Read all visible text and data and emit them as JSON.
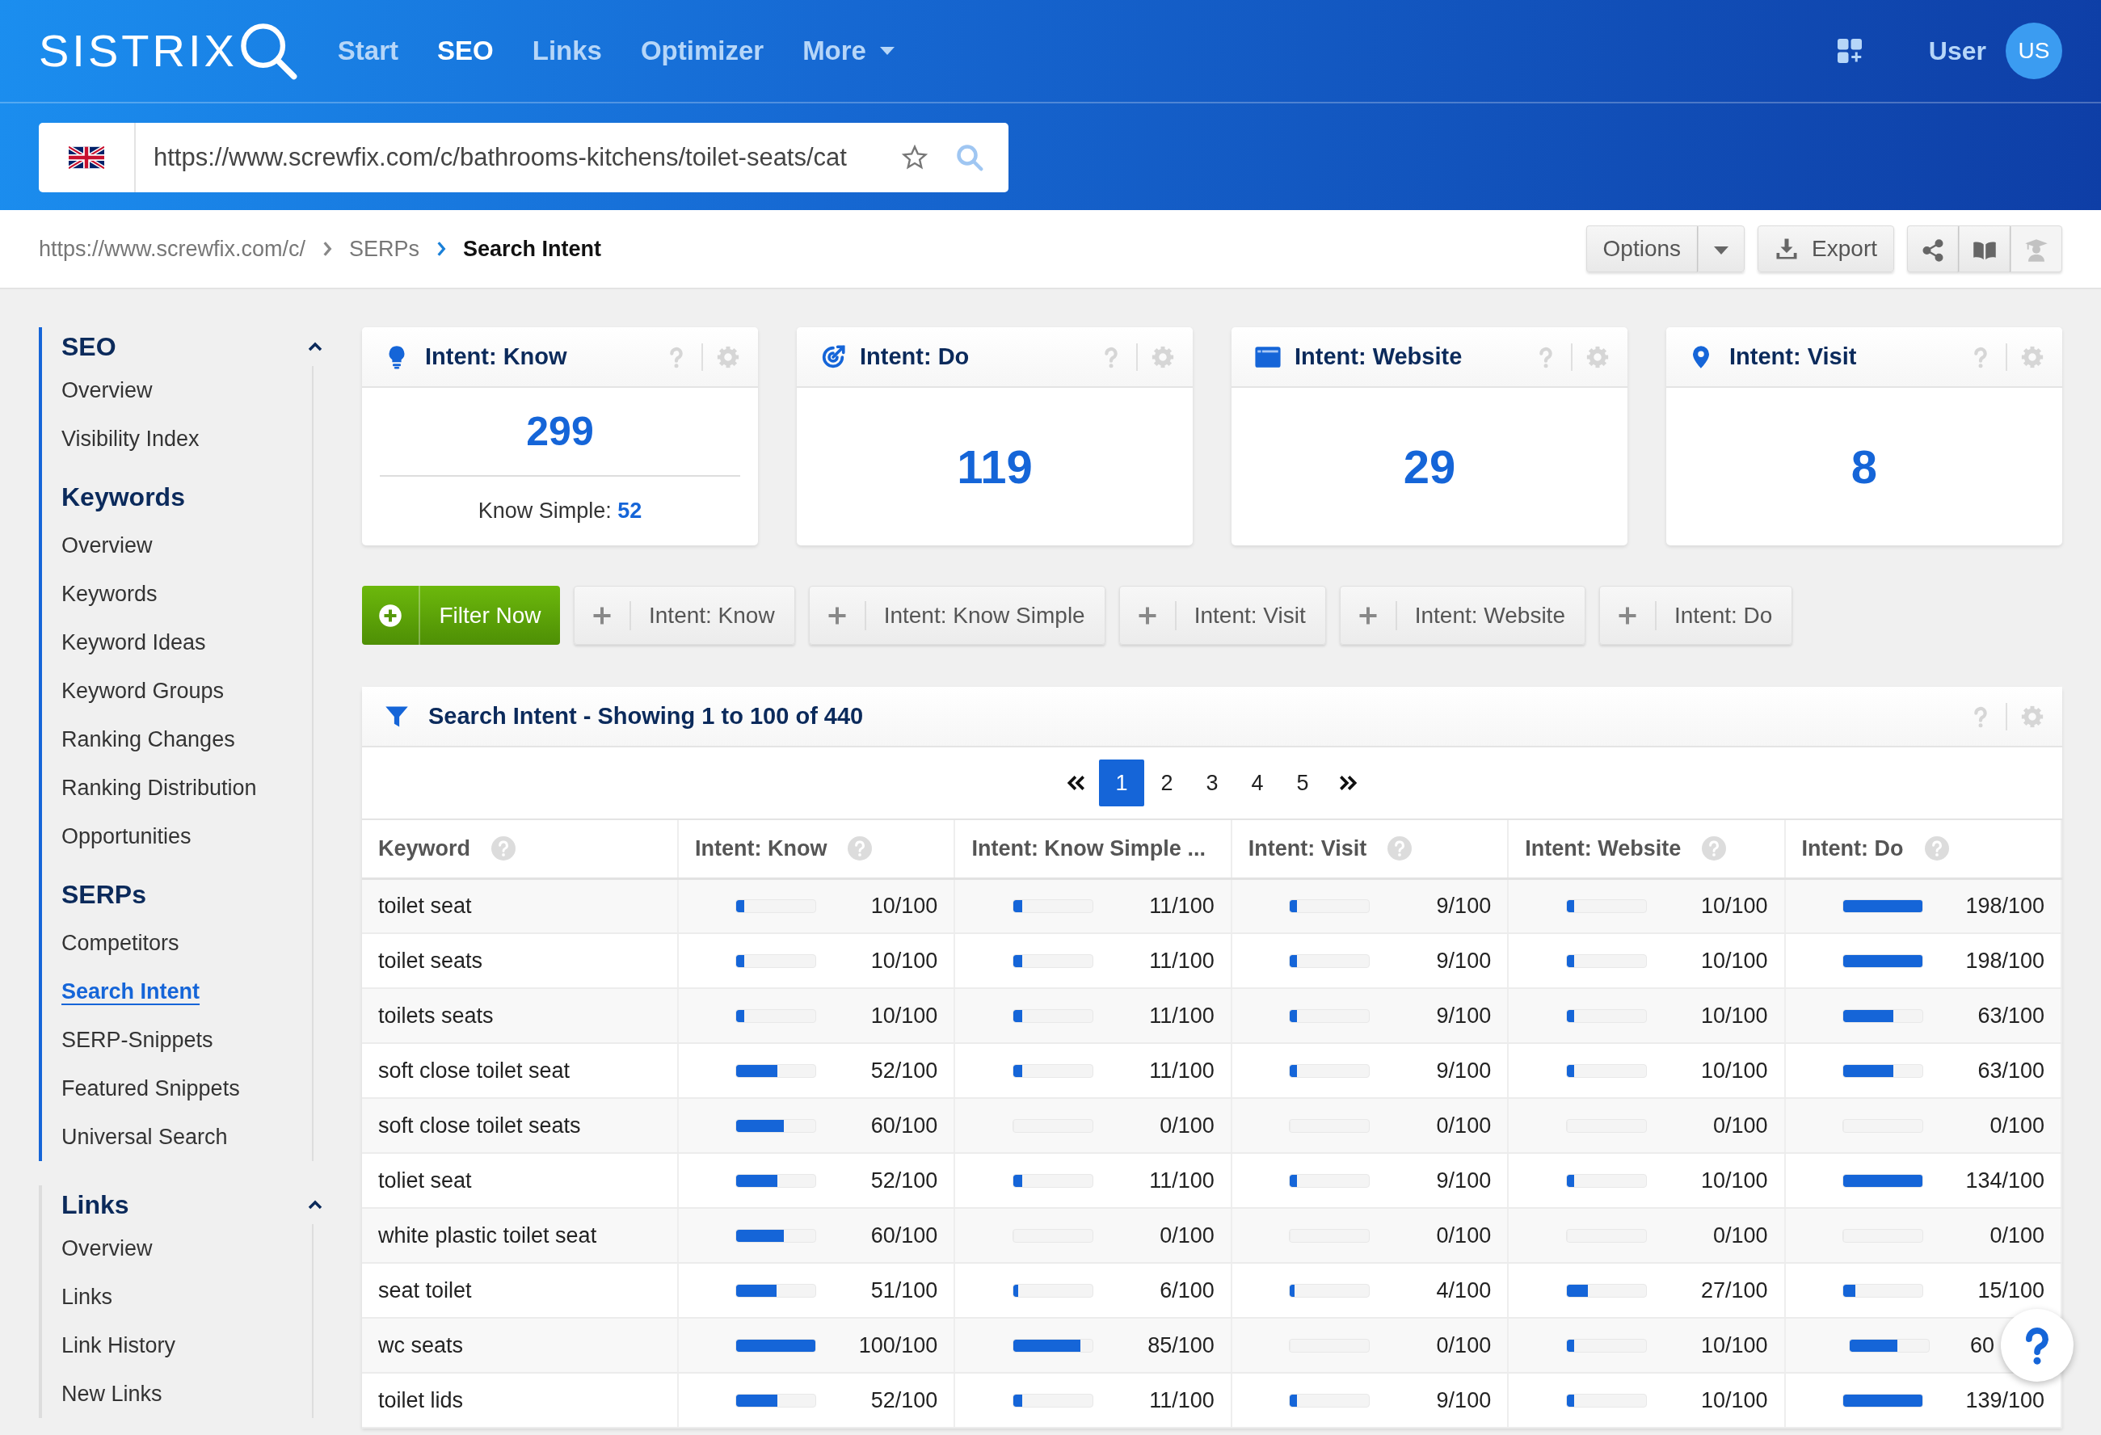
{
  "header": {
    "logo": "SISTRIX",
    "nav": [
      {
        "label": "Start",
        "selected": false,
        "kind": "link"
      },
      {
        "label": "SEO",
        "selected": true,
        "kind": "link"
      },
      {
        "label": "Links",
        "selected": false,
        "kind": "link"
      },
      {
        "label": "Optimizer",
        "selected": false,
        "kind": "link"
      },
      {
        "label": "More",
        "selected": false,
        "kind": "menu"
      }
    ],
    "user": "User",
    "avatar": "US"
  },
  "search": {
    "value": "https://www.screwfix.com/c/bathrooms-kitchens/toilet-seats/cat"
  },
  "breadcrumb": [
    {
      "label": "https://www.screwfix.com/c/",
      "current": false
    },
    {
      "label": "SERPs",
      "current": false
    },
    {
      "label": "Search Intent",
      "current": true
    }
  ],
  "toolbar": {
    "options": "Options",
    "export": "Export"
  },
  "sidebar": [
    {
      "title": "SEO",
      "expanded": true,
      "active": true,
      "groups": [
        {
          "items": [
            {
              "label": "Overview",
              "selected": false
            },
            {
              "label": "Visibility Index",
              "selected": false
            }
          ]
        },
        {
          "title": "Keywords",
          "items": [
            {
              "label": "Overview",
              "selected": false
            },
            {
              "label": "Keywords",
              "selected": false
            },
            {
              "label": "Keyword Ideas",
              "selected": false
            },
            {
              "label": "Keyword Groups",
              "selected": false
            },
            {
              "label": "Ranking Changes",
              "selected": false
            },
            {
              "label": "Ranking Distribution",
              "selected": false
            },
            {
              "label": "Opportunities",
              "selected": false
            }
          ]
        },
        {
          "title": "SERPs",
          "items": [
            {
              "label": "Competitors",
              "selected": false
            },
            {
              "label": "Search Intent",
              "selected": true
            },
            {
              "label": "SERP-Snippets",
              "selected": false
            },
            {
              "label": "Featured Snippets",
              "selected": false
            },
            {
              "label": "Universal Search",
              "selected": false
            }
          ]
        }
      ]
    },
    {
      "title": "Links",
      "expanded": true,
      "active": false,
      "groups": [
        {
          "items": [
            {
              "label": "Overview",
              "selected": false
            },
            {
              "label": "Links",
              "selected": false
            },
            {
              "label": "Link History",
              "selected": false
            },
            {
              "label": "New Links",
              "selected": false
            }
          ]
        }
      ]
    }
  ],
  "cards": [
    {
      "kind": "know",
      "title": "Intent: Know",
      "value": "299",
      "sub_label": "Know Simple:",
      "sub_value": "52"
    },
    {
      "kind": "do",
      "title": "Intent: Do",
      "value": "119"
    },
    {
      "kind": "website",
      "title": "Intent: Website",
      "value": "29"
    },
    {
      "kind": "visit",
      "title": "Intent: Visit",
      "value": "8"
    }
  ],
  "filters": {
    "filter_now": "Filter Now",
    "chips": [
      "Intent: Know",
      "Intent: Know Simple",
      "Intent: Visit",
      "Intent: Website",
      "Intent: Do"
    ]
  },
  "table": {
    "title": "Search Intent - Showing 1 to 100 of 440",
    "pages": [
      {
        "label": "1",
        "selected": true
      },
      {
        "label": "2",
        "selected": false
      },
      {
        "label": "3",
        "selected": false
      },
      {
        "label": "4",
        "selected": false
      },
      {
        "label": "5",
        "selected": false
      }
    ],
    "columns": [
      {
        "label": "Keyword",
        "help": true
      },
      {
        "label": "Intent: Know",
        "help": true
      },
      {
        "label": "Intent: Know Simple ...",
        "help": false
      },
      {
        "label": "Intent: Visit",
        "help": true
      },
      {
        "label": "Intent: Website",
        "help": true
      },
      {
        "label": "Intent: Do",
        "help": true
      }
    ],
    "rows": [
      {
        "keyword": "toilet seat",
        "scores": [
          {
            "text": "10/100",
            "level": 0.1
          },
          {
            "text": "11/100",
            "level": 0.11
          },
          {
            "text": "9/100",
            "level": 0.09
          },
          {
            "text": "10/100",
            "level": 0.1
          },
          {
            "text": "198/100",
            "level": 1
          }
        ]
      },
      {
        "keyword": "toilet seats",
        "scores": [
          {
            "text": "10/100",
            "level": 0.1
          },
          {
            "text": "11/100",
            "level": 0.11
          },
          {
            "text": "9/100",
            "level": 0.09
          },
          {
            "text": "10/100",
            "level": 0.1
          },
          {
            "text": "198/100",
            "level": 1
          }
        ]
      },
      {
        "keyword": "toilets seats",
        "scores": [
          {
            "text": "10/100",
            "level": 0.1
          },
          {
            "text": "11/100",
            "level": 0.11
          },
          {
            "text": "9/100",
            "level": 0.09
          },
          {
            "text": "10/100",
            "level": 0.1
          },
          {
            "text": "63/100",
            "level": 0.63
          }
        ]
      },
      {
        "keyword": "soft close toilet seat",
        "scores": [
          {
            "text": "52/100",
            "level": 0.52
          },
          {
            "text": "11/100",
            "level": 0.11
          },
          {
            "text": "9/100",
            "level": 0.09
          },
          {
            "text": "10/100",
            "level": 0.1
          },
          {
            "text": "63/100",
            "level": 0.63
          }
        ]
      },
      {
        "keyword": "soft close toilet seats",
        "scores": [
          {
            "text": "60/100",
            "level": 0.6
          },
          {
            "text": "0/100",
            "level": 0
          },
          {
            "text": "0/100",
            "level": 0
          },
          {
            "text": "0/100",
            "level": 0
          },
          {
            "text": "0/100",
            "level": 0
          }
        ]
      },
      {
        "keyword": "toliet seat",
        "scores": [
          {
            "text": "52/100",
            "level": 0.52
          },
          {
            "text": "11/100",
            "level": 0.11
          },
          {
            "text": "9/100",
            "level": 0.09
          },
          {
            "text": "10/100",
            "level": 0.1
          },
          {
            "text": "134/100",
            "level": 1
          }
        ]
      },
      {
        "keyword": "white plastic toilet seat",
        "scores": [
          {
            "text": "60/100",
            "level": 0.6
          },
          {
            "text": "0/100",
            "level": 0
          },
          {
            "text": "0/100",
            "level": 0
          },
          {
            "text": "0/100",
            "level": 0
          },
          {
            "text": "0/100",
            "level": 0
          }
        ]
      },
      {
        "keyword": "seat toilet",
        "scores": [
          {
            "text": "51/100",
            "level": 0.51
          },
          {
            "text": "6/100",
            "level": 0.06
          },
          {
            "text": "4/100",
            "level": 0.04
          },
          {
            "text": "27/100",
            "level": 0.27
          },
          {
            "text": "15/100",
            "level": 0.15
          }
        ]
      },
      {
        "keyword": "wc seats",
        "scores": [
          {
            "text": "100/100",
            "level": 1
          },
          {
            "text": "85/100",
            "level": 0.85
          },
          {
            "text": "0/100",
            "level": 0
          },
          {
            "text": "10/100",
            "level": 0.1
          },
          {
            "text": "60",
            "level": 0.6,
            "covered": true
          }
        ]
      },
      {
        "keyword": "toilet lids",
        "scores": [
          {
            "text": "52/100",
            "level": 0.52
          },
          {
            "text": "11/100",
            "level": 0.11
          },
          {
            "text": "9/100",
            "level": 0.09
          },
          {
            "text": "10/100",
            "level": 0.1
          },
          {
            "text": "139/100",
            "level": 1
          }
        ]
      }
    ]
  }
}
